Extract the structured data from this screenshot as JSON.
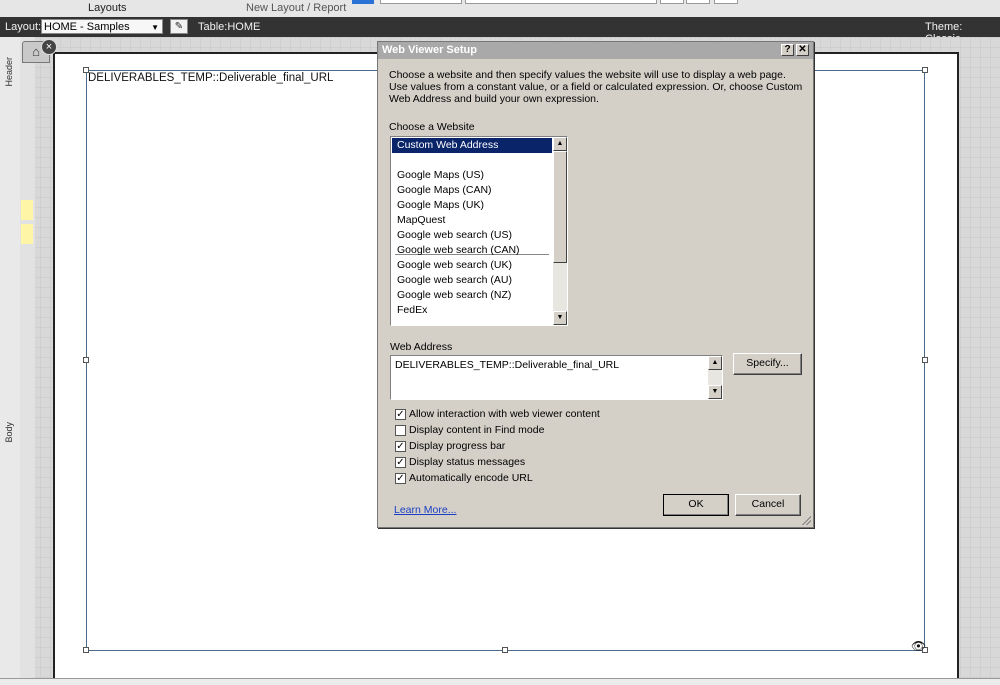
{
  "toolbar": {
    "layouts_label": "Layouts",
    "new_layout_label": "New Layout / Report"
  },
  "layout_bar": {
    "layout_label": "Layout:",
    "layout_value": "HOME - Samples",
    "table_label": "Table:",
    "table_value": "HOME",
    "theme_label": "Theme:",
    "theme_value": "Classic"
  },
  "parts": {
    "header": "Header",
    "body": "Body"
  },
  "canvas": {
    "web_viewer_field": "DELIVERABLES_TEMP::Deliverable_final_URL"
  },
  "dialog": {
    "title": "Web Viewer Setup",
    "help_btn": "?",
    "close_btn": "✕",
    "description": "Choose a website and then specify values the website will use to display a web page. Use values from a constant value, or a field or calculated expression. Or, choose Custom Web Address and build your own expression.",
    "choose_label": "Choose a Website",
    "websites": [
      "Custom Web Address",
      "Google Maps (US)",
      "Google Maps (CAN)",
      "Google Maps (UK)",
      "MapQuest",
      "Google web search (US)",
      "Google web search (CAN)",
      "Google web search (UK)",
      "Google web search (AU)",
      "Google web search (NZ)",
      "FedEx"
    ],
    "web_address_label": "Web Address",
    "web_address_value": "DELIVERABLES_TEMP::Deliverable_final_URL",
    "specify_btn": "Specify...",
    "options": [
      {
        "label": "Allow interaction with web viewer content",
        "checked": true
      },
      {
        "label": "Display content in Find mode",
        "checked": false
      },
      {
        "label": "Display progress bar",
        "checked": true
      },
      {
        "label": "Display status messages",
        "checked": true
      },
      {
        "label": "Automatically encode URL",
        "checked": true
      }
    ],
    "learn_more": "Learn More...",
    "ok_btn": "OK",
    "cancel_btn": "Cancel"
  }
}
